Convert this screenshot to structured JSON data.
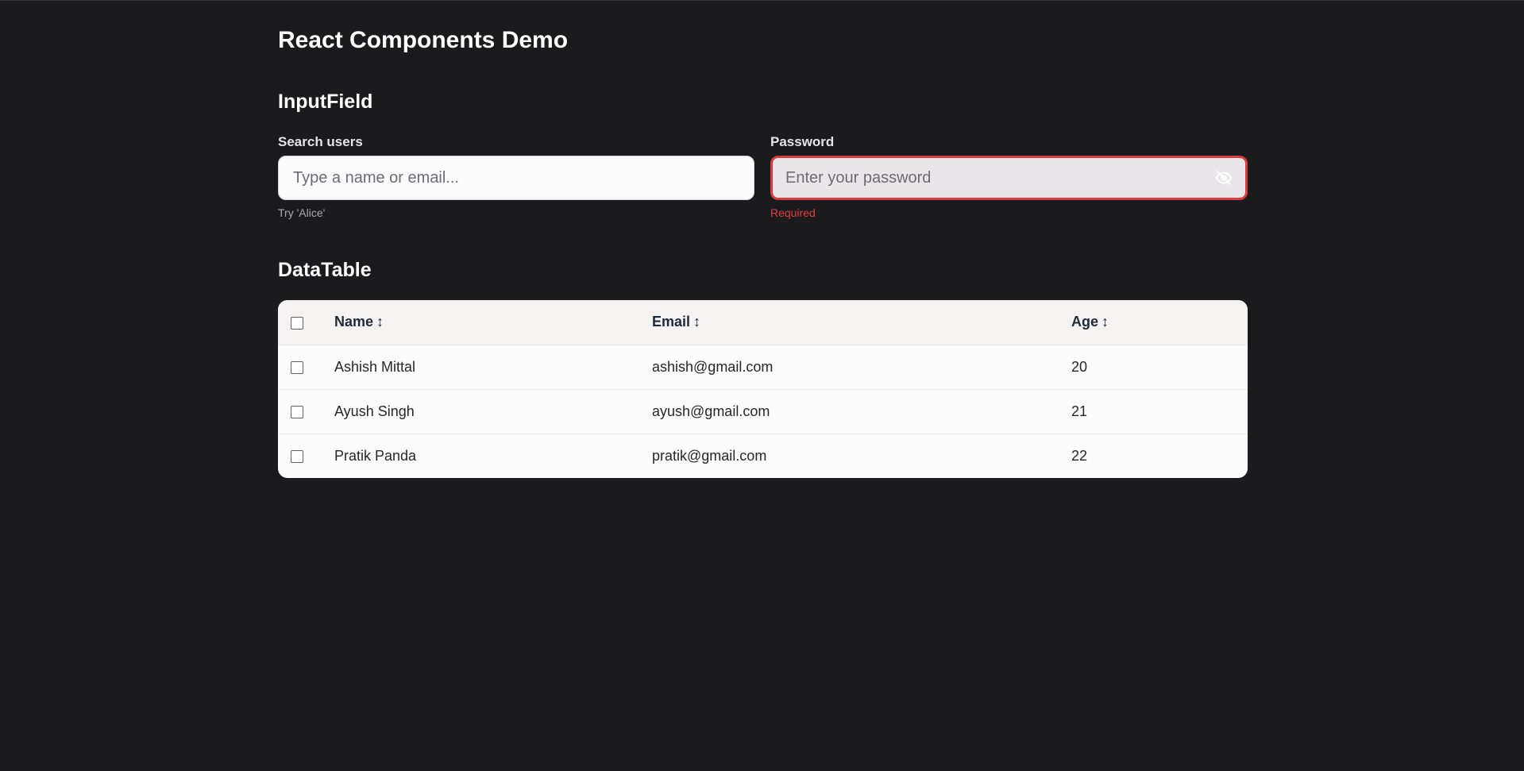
{
  "page": {
    "title": "React Components Demo"
  },
  "sections": {
    "input_heading": "InputField",
    "table_heading": "DataTable"
  },
  "search_field": {
    "label": "Search users",
    "placeholder": "Type a name or email...",
    "value": "",
    "helper": "Try 'Alice'"
  },
  "password_field": {
    "label": "Password",
    "placeholder": "Enter your password",
    "value": "",
    "error": "Required",
    "icon": "eye-off-icon"
  },
  "table": {
    "columns": [
      {
        "label": "Name",
        "sort_icon": "↕"
      },
      {
        "label": "Email",
        "sort_icon": "↕"
      },
      {
        "label": "Age",
        "sort_icon": "↕"
      }
    ],
    "rows": [
      {
        "name": "Ashish Mittal",
        "email": "ashish@gmail.com",
        "age": "20"
      },
      {
        "name": "Ayush Singh",
        "email": "ayush@gmail.com",
        "age": "21"
      },
      {
        "name": "Pratik Panda",
        "email": "pratik@gmail.com",
        "age": "22"
      }
    ]
  },
  "colors": {
    "background": "#1b1b1d",
    "error": "#dc3b3b",
    "surface": "#fbfbfb"
  }
}
